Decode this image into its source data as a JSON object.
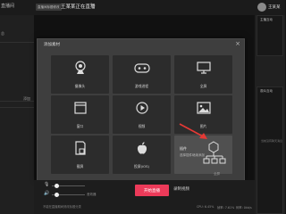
{
  "app": {
    "title": "直播间"
  },
  "header": {
    "room_badge": "直播间标题修改",
    "room_title": "王某某正在直播",
    "user_name": "王某某"
  },
  "left_panel": {
    "label_top": "总",
    "label_mid": "场景",
    "label_bottom": "添加"
  },
  "right_panel": {
    "top_label": "主播互动",
    "mid_label": "观众互动",
    "note": "当前没有聊天消息"
  },
  "modal": {
    "title": "添加素材",
    "close": "×",
    "tiles": [
      {
        "label": "摄像头",
        "icon": "camera-icon"
      },
      {
        "label": "游戏进程",
        "icon": "gamepad-icon"
      },
      {
        "label": "全屏",
        "icon": "monitor-icon"
      },
      {
        "label": "窗口",
        "icon": "window-icon"
      },
      {
        "label": "视频",
        "icon": "play-icon"
      },
      {
        "label": "图片",
        "icon": "image-icon"
      },
      {
        "label": "截屏",
        "icon": "screenshot-icon"
      },
      {
        "label": "投屏(iOS)",
        "icon": "apple-icon"
      }
    ],
    "plugin_tile": {
      "title": "插件",
      "subtitle": "选择插件继续添加",
      "icon": "plugin-icon"
    }
  },
  "bottom": {
    "mic_label": "",
    "speaker_label": "音效器",
    "start_button": "开始直播",
    "record_button": "录制视频",
    "footer_note": "不能在直播期间修改标题分类",
    "corner": "全屏",
    "cpu": "CPU: 6.45%",
    "fps": "帧率: 7.61%",
    "bitrate": "码率: 0kb/s"
  },
  "colors": {
    "accent": "#ec3a59",
    "modal_bg": "#3e3e3e",
    "tile_bg": "#2c2c2c",
    "arrow": "#e53935"
  }
}
